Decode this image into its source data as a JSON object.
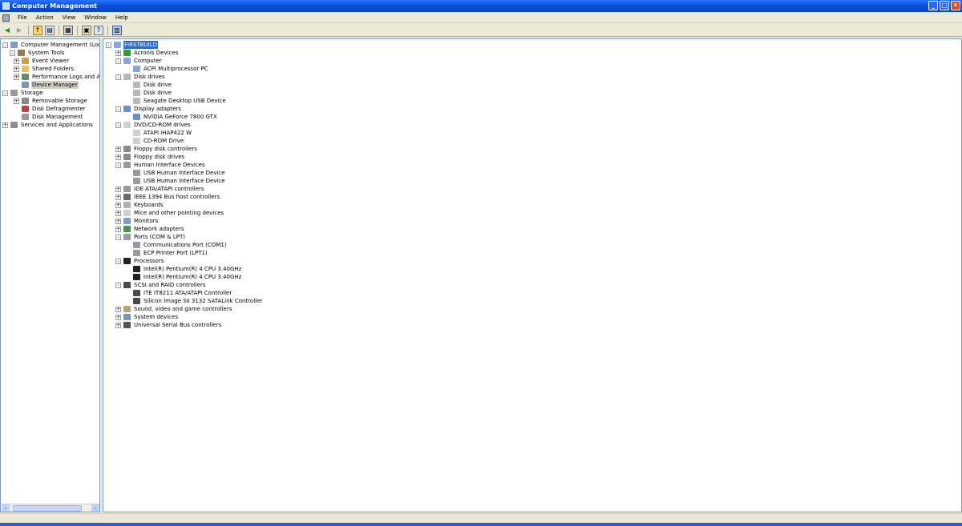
{
  "window": {
    "title": "Computer Management",
    "minimize": "_",
    "maximize": "□",
    "close": "✕"
  },
  "menu": [
    "File",
    "Action",
    "View",
    "Window",
    "Help"
  ],
  "toolbar": [
    "back-icon",
    "forward-icon",
    "up-icon",
    "show-hide-tree-icon",
    "print-icon",
    "properties-icon",
    "help-icon",
    "scan-hardware-icon"
  ],
  "left_tree": [
    {
      "label": "Computer Management (Local)",
      "depth": 0,
      "exp": "-",
      "icon": "computer-management-icon"
    },
    {
      "label": "System Tools",
      "depth": 1,
      "exp": "-",
      "icon": "system-tools-icon"
    },
    {
      "label": "Event Viewer",
      "depth": 2,
      "exp": "+",
      "icon": "event-viewer-icon"
    },
    {
      "label": "Shared Folders",
      "depth": 2,
      "exp": "+",
      "icon": "shared-folders-icon"
    },
    {
      "label": "Performance Logs and Alerts",
      "depth": 2,
      "exp": "+",
      "icon": "performance-logs-icon"
    },
    {
      "label": "Device Manager",
      "depth": 2,
      "exp": "",
      "icon": "device-manager-icon",
      "selected": true
    },
    {
      "label": "Storage",
      "depth": 0,
      "exp": "-",
      "icon": "storage-icon"
    },
    {
      "label": "Removable Storage",
      "depth": 2,
      "exp": "+",
      "icon": "removable-storage-icon"
    },
    {
      "label": "Disk Defragmenter",
      "depth": 2,
      "exp": "",
      "icon": "defragmenter-icon"
    },
    {
      "label": "Disk Management",
      "depth": 2,
      "exp": "",
      "icon": "disk-management-icon"
    },
    {
      "label": "Services and Applications",
      "depth": 0,
      "exp": "+",
      "icon": "services-icon"
    }
  ],
  "device_tree": [
    {
      "label": "FIRSTBUILD",
      "depth": 0,
      "exp": "-",
      "icon": "computer-icon",
      "selected": true
    },
    {
      "label": "Acronis Devices",
      "depth": 1,
      "exp": "+",
      "icon": "acronis-icon"
    },
    {
      "label": "Computer",
      "depth": 1,
      "exp": "-",
      "icon": "computer-icon"
    },
    {
      "label": "ACPI Multiprocessor PC",
      "depth": 2,
      "exp": "",
      "icon": "computer-icon"
    },
    {
      "label": "Disk drives",
      "depth": 1,
      "exp": "-",
      "icon": "disk-drive-icon"
    },
    {
      "label": "Disk drive",
      "depth": 2,
      "exp": "",
      "icon": "disk-drive-icon"
    },
    {
      "label": "Disk drive",
      "depth": 2,
      "exp": "",
      "icon": "disk-drive-icon"
    },
    {
      "label": "Seagate Desktop USB Device",
      "depth": 2,
      "exp": "",
      "icon": "disk-drive-icon"
    },
    {
      "label": "Display adapters",
      "depth": 1,
      "exp": "-",
      "icon": "display-adapter-icon"
    },
    {
      "label": "NVIDIA GeForce 7800 GTX",
      "depth": 2,
      "exp": "",
      "icon": "display-adapter-icon"
    },
    {
      "label": "DVD/CD-ROM drives",
      "depth": 1,
      "exp": "-",
      "icon": "cdrom-icon"
    },
    {
      "label": "ATAPI iHAP422   W",
      "depth": 2,
      "exp": "",
      "icon": "cdrom-icon"
    },
    {
      "label": "CD-ROM Drive",
      "depth": 2,
      "exp": "",
      "icon": "cdrom-icon"
    },
    {
      "label": "Floppy disk controllers",
      "depth": 1,
      "exp": "+",
      "icon": "floppy-controller-icon"
    },
    {
      "label": "Floppy disk drives",
      "depth": 1,
      "exp": "+",
      "icon": "floppy-drive-icon"
    },
    {
      "label": "Human Interface Devices",
      "depth": 1,
      "exp": "-",
      "icon": "hid-icon"
    },
    {
      "label": "USB Human Interface Device",
      "depth": 2,
      "exp": "",
      "icon": "hid-icon"
    },
    {
      "label": "USB Human Interface Device",
      "depth": 2,
      "exp": "",
      "icon": "hid-icon"
    },
    {
      "label": "IDE ATA/ATAPI controllers",
      "depth": 1,
      "exp": "+",
      "icon": "ide-controller-icon"
    },
    {
      "label": "IEEE 1394 Bus host controllers",
      "depth": 1,
      "exp": "+",
      "icon": "ieee1394-icon"
    },
    {
      "label": "Keyboards",
      "depth": 1,
      "exp": "+",
      "icon": "keyboard-icon"
    },
    {
      "label": "Mice and other pointing devices",
      "depth": 1,
      "exp": "+",
      "icon": "mouse-icon"
    },
    {
      "label": "Monitors",
      "depth": 1,
      "exp": "+",
      "icon": "monitor-icon"
    },
    {
      "label": "Network adapters",
      "depth": 1,
      "exp": "+",
      "icon": "network-adapter-icon"
    },
    {
      "label": "Ports (COM & LPT)",
      "depth": 1,
      "exp": "-",
      "icon": "port-icon"
    },
    {
      "label": "Communications Port (COM1)",
      "depth": 2,
      "exp": "",
      "icon": "port-icon"
    },
    {
      "label": "ECP Printer Port (LPT1)",
      "depth": 2,
      "exp": "",
      "icon": "port-icon"
    },
    {
      "label": "Processors",
      "depth": 1,
      "exp": "-",
      "icon": "processor-icon"
    },
    {
      "label": "Intel(R) Pentium(R) 4 CPU 3.40GHz",
      "depth": 2,
      "exp": "",
      "icon": "processor-icon"
    },
    {
      "label": "Intel(R) Pentium(R) 4 CPU 3.40GHz",
      "depth": 2,
      "exp": "",
      "icon": "processor-icon"
    },
    {
      "label": "SCSI and RAID controllers",
      "depth": 1,
      "exp": "-",
      "icon": "scsi-icon"
    },
    {
      "label": "ITE IT8211 ATA/ATAPI Controller",
      "depth": 2,
      "exp": "",
      "icon": "scsi-icon"
    },
    {
      "label": "Silicon Image SiI 3132 SATALink Controller",
      "depth": 2,
      "exp": "",
      "icon": "scsi-icon"
    },
    {
      "label": "Sound, video and game controllers",
      "depth": 1,
      "exp": "+",
      "icon": "sound-icon"
    },
    {
      "label": "System devices",
      "depth": 1,
      "exp": "+",
      "icon": "system-devices-icon"
    },
    {
      "label": "Universal Serial Bus controllers",
      "depth": 1,
      "exp": "+",
      "icon": "usb-icon"
    }
  ],
  "colors": {
    "title_blue": "#0a4fd9",
    "selection": "#316ac5",
    "window_bg": "#ECE9D8"
  }
}
